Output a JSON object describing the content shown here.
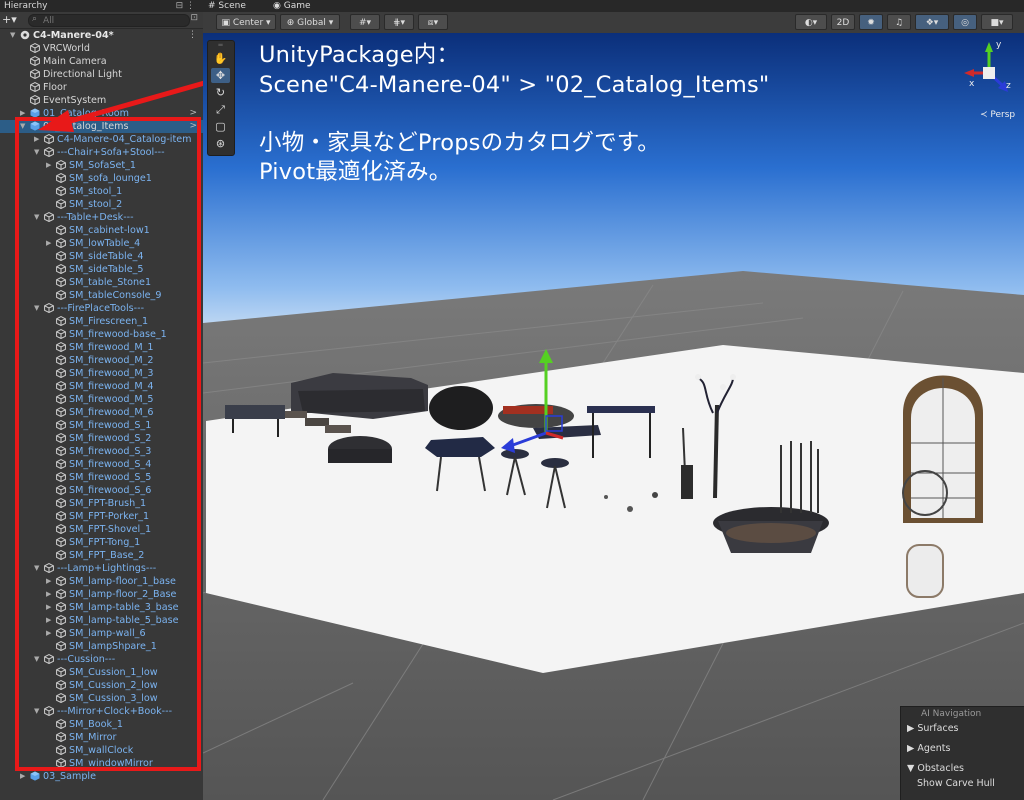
{
  "hierarchy": {
    "tab_title": "Hierarchy",
    "tab_controls": "⊟ ⋮",
    "add_label": "+▾",
    "search_placeholder": "All",
    "options_icon": "⊡",
    "items": [
      {
        "label": "C4-Manere-04*",
        "depth": 0,
        "arrow": "▼",
        "icon": "unity-scene-icon",
        "style": "root",
        "more": "⋮"
      },
      {
        "label": "VRCWorld",
        "depth": 1,
        "arrow": "",
        "icon": "gameobject-icon",
        "style": "plain"
      },
      {
        "label": "Main Camera",
        "depth": 1,
        "arrow": "",
        "icon": "gameobject-icon",
        "style": "plain"
      },
      {
        "label": "Directional Light",
        "depth": 1,
        "arrow": "",
        "icon": "gameobject-icon",
        "style": "plain"
      },
      {
        "label": "Floor",
        "depth": 1,
        "arrow": "",
        "icon": "gameobject-icon",
        "style": "plain"
      },
      {
        "label": "EventSystem",
        "depth": 1,
        "arrow": "",
        "icon": "gameobject-icon",
        "style": "plain"
      },
      {
        "label": "01_Catalog_Room",
        "depth": 1,
        "arrow": "▶",
        "icon": "prefab-icon",
        "style": "blue",
        "more": ">"
      },
      {
        "label": "02_Catalog_Items",
        "depth": 1,
        "arrow": "▼",
        "icon": "prefab-icon",
        "style": "plain",
        "selected": true,
        "more": ">"
      },
      {
        "label": "C4-Manere-04_Catalog-item",
        "depth": 2,
        "arrow": "▶",
        "icon": "gameobject-icon",
        "style": "blue"
      },
      {
        "label": "---Chair+Sofa+Stool---",
        "depth": 2,
        "arrow": "▼",
        "icon": "gameobject-icon",
        "style": "blue"
      },
      {
        "label": "SM_SofaSet_1",
        "depth": 3,
        "arrow": "▶",
        "icon": "gameobject-icon",
        "style": "blue"
      },
      {
        "label": "SM_sofa_lounge1",
        "depth": 3,
        "arrow": "",
        "icon": "gameobject-icon",
        "style": "blue"
      },
      {
        "label": "SM_stool_1",
        "depth": 3,
        "arrow": "",
        "icon": "gameobject-icon",
        "style": "blue"
      },
      {
        "label": "SM_stool_2",
        "depth": 3,
        "arrow": "",
        "icon": "gameobject-icon",
        "style": "blue"
      },
      {
        "label": "---Table+Desk---",
        "depth": 2,
        "arrow": "▼",
        "icon": "gameobject-icon",
        "style": "blue"
      },
      {
        "label": "SM_cabinet-low1",
        "depth": 3,
        "arrow": "",
        "icon": "gameobject-icon",
        "style": "blue"
      },
      {
        "label": "SM_lowTable_4",
        "depth": 3,
        "arrow": "▶",
        "icon": "gameobject-icon",
        "style": "blue"
      },
      {
        "label": "SM_sideTable_4",
        "depth": 3,
        "arrow": "",
        "icon": "gameobject-icon",
        "style": "blue"
      },
      {
        "label": "SM_sideTable_5",
        "depth": 3,
        "arrow": "",
        "icon": "gameobject-icon",
        "style": "blue"
      },
      {
        "label": "SM_table_Stone1",
        "depth": 3,
        "arrow": "",
        "icon": "gameobject-icon",
        "style": "blue"
      },
      {
        "label": "SM_tableConsole_9",
        "depth": 3,
        "arrow": "",
        "icon": "gameobject-icon",
        "style": "blue"
      },
      {
        "label": "---FirePlaceTools---",
        "depth": 2,
        "arrow": "▼",
        "icon": "gameobject-icon",
        "style": "blue"
      },
      {
        "label": "SM_Firescreen_1",
        "depth": 3,
        "arrow": "",
        "icon": "gameobject-icon",
        "style": "blue"
      },
      {
        "label": "SM_firewood-base_1",
        "depth": 3,
        "arrow": "",
        "icon": "gameobject-icon",
        "style": "blue"
      },
      {
        "label": "SM_firewood_M_1",
        "depth": 3,
        "arrow": "",
        "icon": "gameobject-icon",
        "style": "blue"
      },
      {
        "label": "SM_firewood_M_2",
        "depth": 3,
        "arrow": "",
        "icon": "gameobject-icon",
        "style": "blue"
      },
      {
        "label": "SM_firewood_M_3",
        "depth": 3,
        "arrow": "",
        "icon": "gameobject-icon",
        "style": "blue"
      },
      {
        "label": "SM_firewood_M_4",
        "depth": 3,
        "arrow": "",
        "icon": "gameobject-icon",
        "style": "blue"
      },
      {
        "label": "SM_firewood_M_5",
        "depth": 3,
        "arrow": "",
        "icon": "gameobject-icon",
        "style": "blue"
      },
      {
        "label": "SM_firewood_M_6",
        "depth": 3,
        "arrow": "",
        "icon": "gameobject-icon",
        "style": "blue"
      },
      {
        "label": "SM_firewood_S_1",
        "depth": 3,
        "arrow": "",
        "icon": "gameobject-icon",
        "style": "blue"
      },
      {
        "label": "SM_firewood_S_2",
        "depth": 3,
        "arrow": "",
        "icon": "gameobject-icon",
        "style": "blue"
      },
      {
        "label": "SM_firewood_S_3",
        "depth": 3,
        "arrow": "",
        "icon": "gameobject-icon",
        "style": "blue"
      },
      {
        "label": "SM_firewood_S_4",
        "depth": 3,
        "arrow": "",
        "icon": "gameobject-icon",
        "style": "blue"
      },
      {
        "label": "SM_firewood_S_5",
        "depth": 3,
        "arrow": "",
        "icon": "gameobject-icon",
        "style": "blue"
      },
      {
        "label": "SM_firewood_S_6",
        "depth": 3,
        "arrow": "",
        "icon": "gameobject-icon",
        "style": "blue"
      },
      {
        "label": "SM_FPT-Brush_1",
        "depth": 3,
        "arrow": "",
        "icon": "gameobject-icon",
        "style": "blue"
      },
      {
        "label": "SM_FPT-Porker_1",
        "depth": 3,
        "arrow": "",
        "icon": "gameobject-icon",
        "style": "blue"
      },
      {
        "label": "SM_FPT-Shovel_1",
        "depth": 3,
        "arrow": "",
        "icon": "gameobject-icon",
        "style": "blue"
      },
      {
        "label": "SM_FPT-Tong_1",
        "depth": 3,
        "arrow": "",
        "icon": "gameobject-icon",
        "style": "blue"
      },
      {
        "label": "SM_FPT_Base_2",
        "depth": 3,
        "arrow": "",
        "icon": "gameobject-icon",
        "style": "blue"
      },
      {
        "label": "---Lamp+Lightings---",
        "depth": 2,
        "arrow": "▼",
        "icon": "gameobject-icon",
        "style": "blue"
      },
      {
        "label": "SM_lamp-floor_1_base",
        "depth": 3,
        "arrow": "▶",
        "icon": "gameobject-icon",
        "style": "blue"
      },
      {
        "label": "SM_lamp-floor_2_Base",
        "depth": 3,
        "arrow": "▶",
        "icon": "gameobject-icon",
        "style": "blue"
      },
      {
        "label": "SM_lamp-table_3_base",
        "depth": 3,
        "arrow": "▶",
        "icon": "gameobject-icon",
        "style": "blue"
      },
      {
        "label": "SM_lamp-table_5_base",
        "depth": 3,
        "arrow": "▶",
        "icon": "gameobject-icon",
        "style": "blue"
      },
      {
        "label": "SM_lamp-wall_6",
        "depth": 3,
        "arrow": "▶",
        "icon": "gameobject-icon",
        "style": "blue"
      },
      {
        "label": "SM_lampShpare_1",
        "depth": 3,
        "arrow": "",
        "icon": "gameobject-icon",
        "style": "blue"
      },
      {
        "label": "---Cussion---",
        "depth": 2,
        "arrow": "▼",
        "icon": "gameobject-icon",
        "style": "blue"
      },
      {
        "label": "SM_Cussion_1_low",
        "depth": 3,
        "arrow": "",
        "icon": "gameobject-icon",
        "style": "blue"
      },
      {
        "label": "SM_Cussion_2_low",
        "depth": 3,
        "arrow": "",
        "icon": "gameobject-icon",
        "style": "blue"
      },
      {
        "label": "SM_Cussion_3_low",
        "depth": 3,
        "arrow": "",
        "icon": "gameobject-icon",
        "style": "blue"
      },
      {
        "label": "---Mirror+Clock+Book---",
        "depth": 2,
        "arrow": "▼",
        "icon": "gameobject-icon",
        "style": "blue"
      },
      {
        "label": "SM_Book_1",
        "depth": 3,
        "arrow": "",
        "icon": "gameobject-icon",
        "style": "blue"
      },
      {
        "label": "SM_Mirror",
        "depth": 3,
        "arrow": "",
        "icon": "gameobject-icon",
        "style": "blue"
      },
      {
        "label": "SM_wallClock",
        "depth": 3,
        "arrow": "",
        "icon": "gameobject-icon",
        "style": "blue"
      },
      {
        "label": "SM_windowMirror",
        "depth": 3,
        "arrow": "",
        "icon": "gameobject-icon",
        "style": "blue"
      },
      {
        "label": "03_Sample",
        "depth": 1,
        "arrow": "▶",
        "icon": "prefab-icon",
        "style": "blue"
      }
    ]
  },
  "scene": {
    "tabs": [
      {
        "label": "Scene",
        "icon": "hash-icon"
      },
      {
        "label": "Game",
        "icon": "gamepad-icon"
      }
    ],
    "toolbar": {
      "pivot_label": "Center ▾",
      "space_label": "Global ▾",
      "mode_2d": "2D"
    },
    "overlay_lines": [
      "UnityPackage内：",
      "Scene\"C4-Manere-04\" > \"02_Catalog_Items\"",
      "小物・家具などPropsのカタログです。",
      "Pivot最適化済み。"
    ],
    "gizmo_labels": {
      "y": "y",
      "x": "x",
      "z": "z"
    },
    "projection_label": "≺ Persp"
  },
  "ai_navigation": {
    "title": "AI Navigation",
    "items": [
      {
        "arrow": "▶",
        "label": "Surfaces"
      },
      {
        "arrow": "▶",
        "label": "Agents"
      },
      {
        "arrow": "▼",
        "label": "Obstacles"
      },
      {
        "arrow": "",
        "label": "Show Carve Hull"
      }
    ]
  },
  "colors": {
    "annotation_red": "#e81919",
    "selection_blue": "#2c5d87",
    "prefab_text_blue": "#7bb3f0"
  }
}
